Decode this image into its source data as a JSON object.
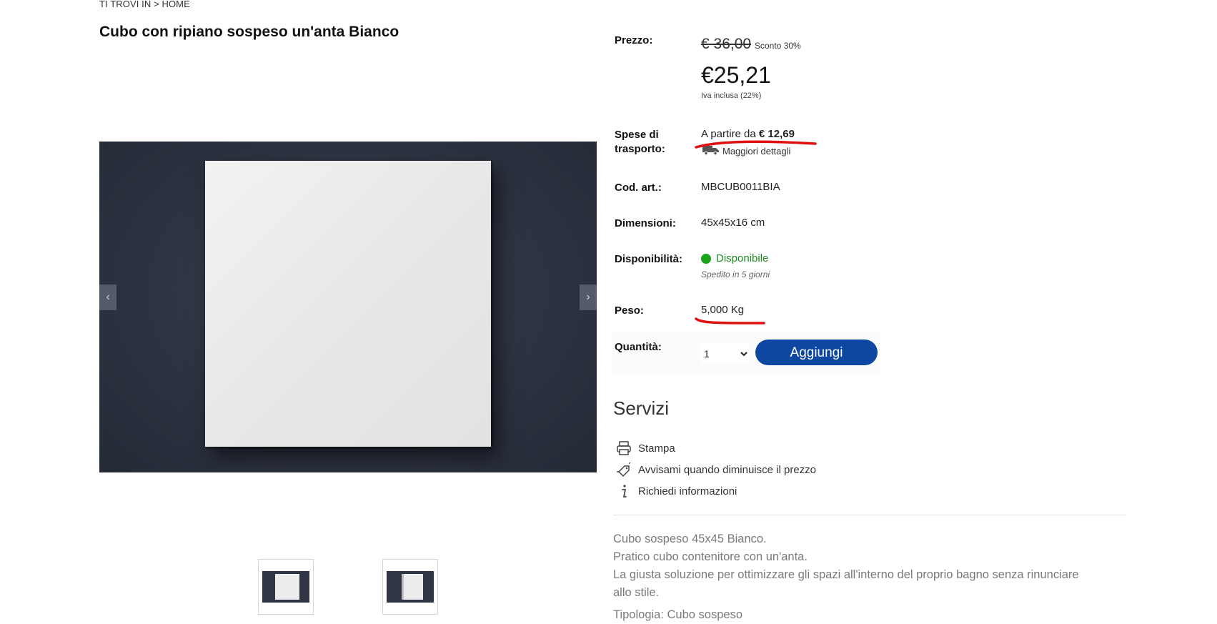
{
  "breadcrumb": "TI TROVI IN > HOME",
  "product": {
    "title": "Cubo con ripiano sospeso un'anta Bianco"
  },
  "labels": {
    "price": "Prezzo:",
    "shipping_1": "Spese di",
    "shipping_2": "trasporto:",
    "code": "Cod. art.:",
    "dimensions": "Dimensioni:",
    "availability": "Disponibilità:",
    "weight": "Peso:",
    "quantity": "Quantità:"
  },
  "price": {
    "old": "€ 36,00",
    "discount": "Sconto 30%",
    "current": "€25,21",
    "vat": "Iva inclusa (22%)"
  },
  "shipping": {
    "prefix": "A partire da",
    "amount": "€ 12,69",
    "details_link": "Maggiori dettagli",
    "icon": "truck-icon"
  },
  "code": "MBCUB0011BIA",
  "dimensions": "45x45x16 cm",
  "availability": {
    "status": "Disponibile",
    "status_color": "#1ca31c",
    "shipping_time": "Spedito in 5 giorni"
  },
  "weight": "5,000 Kg",
  "quantity": {
    "selected": "1",
    "options": [
      "1"
    ]
  },
  "add_button": "Aggiungi",
  "accent_color": "#0d47a1",
  "services": {
    "title": "Servizi",
    "items": [
      {
        "label": "Stampa",
        "icon": "printer-icon"
      },
      {
        "label": "Avvisami quando diminuisce il prezzo",
        "icon": "price-tag-icon"
      },
      {
        "label": "Richiedi informazioni",
        "icon": "info-icon"
      }
    ]
  },
  "description": {
    "lines": [
      "Cubo sospeso 45x45 Bianco.",
      "Pratico cubo contenitore con un'anta.",
      "La giusta soluzione per ottimizzare gli spazi all'interno del proprio bagno senza rinunciare",
      "allo stile."
    ],
    "type_line": "Tipologia: Cubo sospeso"
  },
  "gallery": {
    "prev_icon": "chevron-left-icon",
    "next_icon": "chevron-right-icon"
  }
}
